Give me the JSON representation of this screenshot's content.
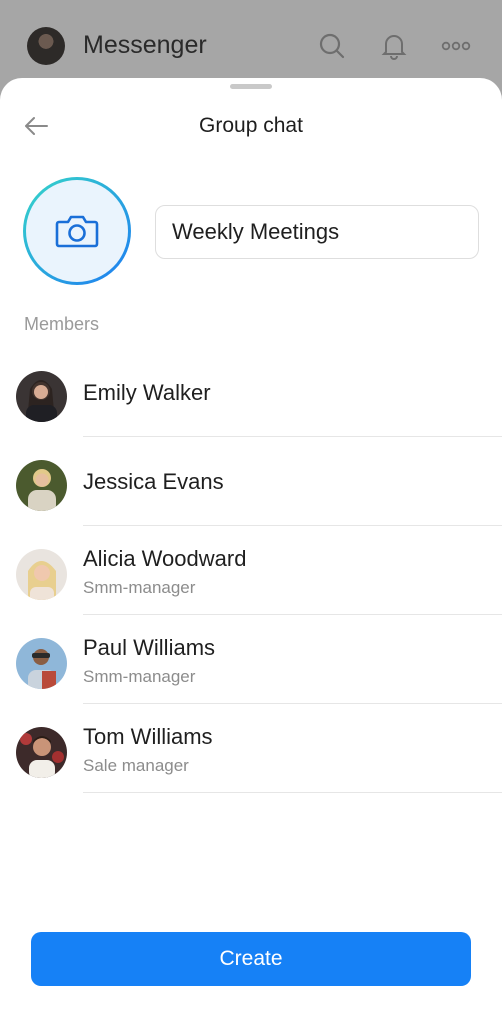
{
  "app": {
    "title": "Messenger"
  },
  "header_icons": [
    "search-icon",
    "bell-icon",
    "more-icon"
  ],
  "sheet": {
    "title": "Group chat",
    "group_name": "Weekly Meetings",
    "members_label": "Members",
    "create_label": "Create"
  },
  "members": [
    {
      "name": "Emily Walker",
      "role": ""
    },
    {
      "name": "Jessica Evans",
      "role": ""
    },
    {
      "name": "Alicia Woodward",
      "role": "Smm-manager"
    },
    {
      "name": "Paul Williams",
      "role": "Smm-manager"
    },
    {
      "name": "Tom Williams",
      "role": "Sale manager"
    }
  ],
  "colors": {
    "accent": "#1681f6",
    "ring_start": "#36d6c8",
    "ring_end": "#1e7cf2",
    "camera": "#1a6fd8"
  }
}
